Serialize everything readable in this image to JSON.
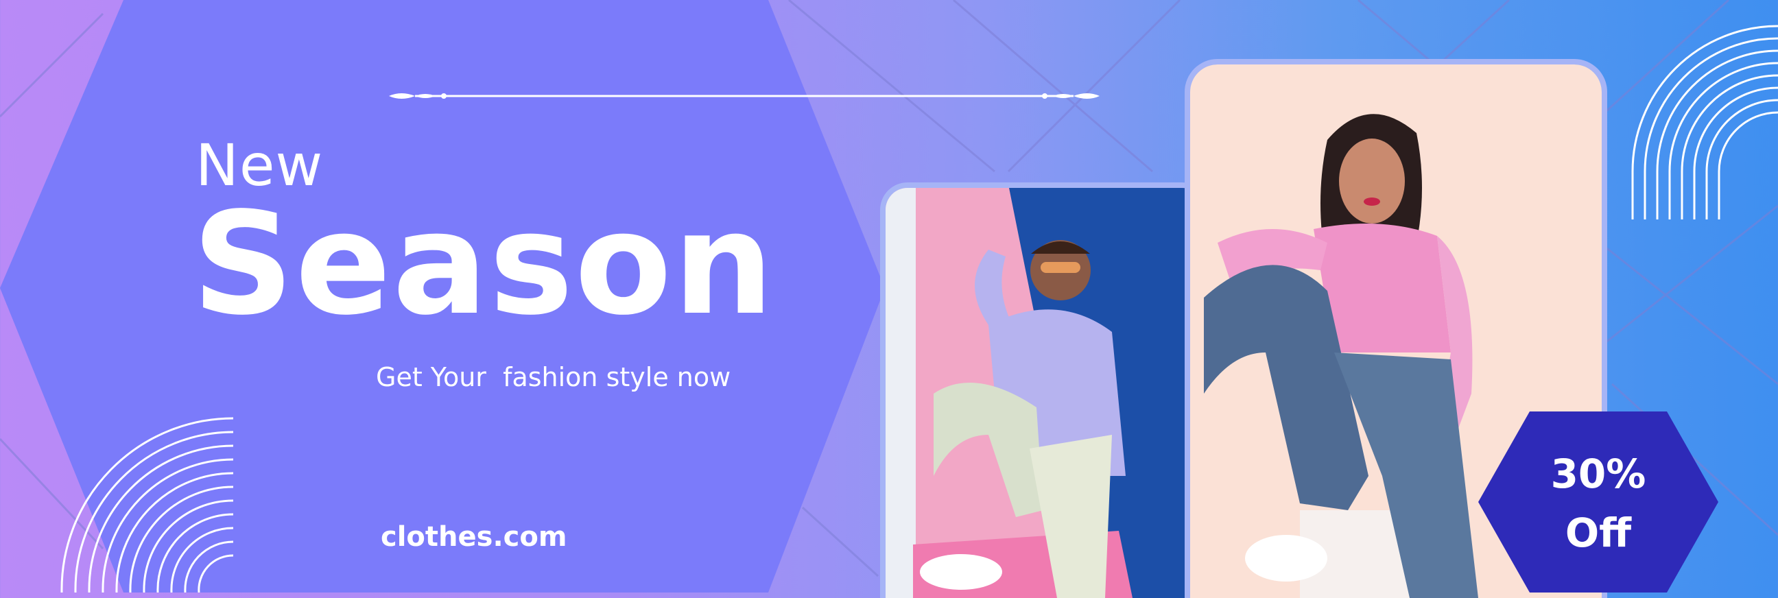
{
  "banner": {
    "title_line1": "New",
    "title_line2": "Season",
    "tagline": "Get Your  fashion style now",
    "website": "clothes.com"
  },
  "badge": {
    "percent": "30%",
    "label": "Off"
  },
  "colors": {
    "hexagon": "#7b7bfa",
    "badge": "#2e2ab8",
    "photo_frame": "#a6b4f6",
    "text": "#ffffff"
  },
  "icons": {
    "ornament": "decorative-divider-icon",
    "arcs": "concentric-arcs-icon"
  }
}
